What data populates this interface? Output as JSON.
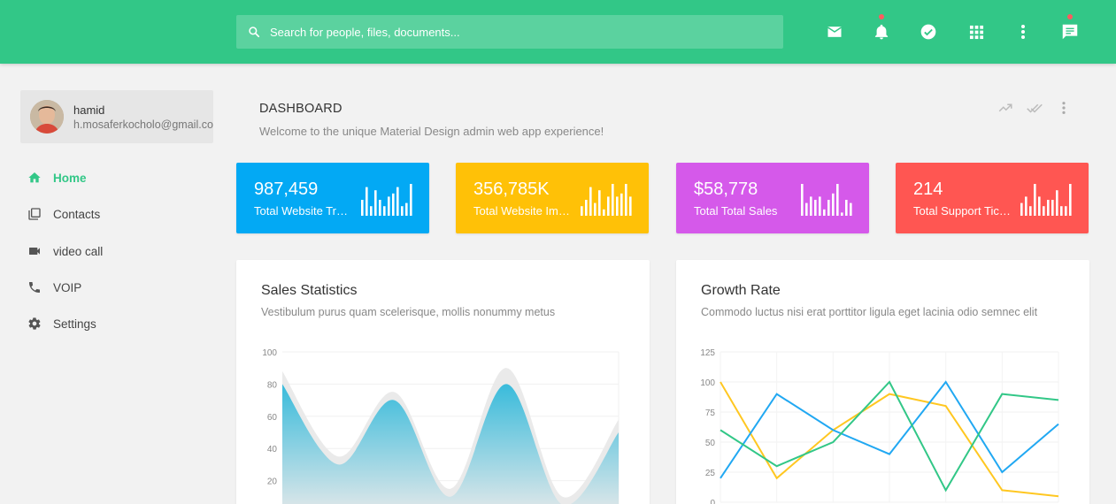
{
  "search": {
    "placeholder": "Search for people, files, documents..."
  },
  "header_icons": [
    "mail-icon",
    "notifications-icon",
    "tasks-check-icon",
    "apps-grid-icon",
    "more-vertical-icon",
    "messages-icon"
  ],
  "profile": {
    "name": "hamid",
    "email": "h.mosaferkocholo@gmail.com"
  },
  "nav": [
    {
      "label": "Home",
      "icon": "home-icon",
      "active": true
    },
    {
      "label": "Contacts",
      "icon": "contacts-icon",
      "active": false
    },
    {
      "label": "video call",
      "icon": "videocam-icon",
      "active": false
    },
    {
      "label": "VOIP",
      "icon": "phone-icon",
      "active": false
    },
    {
      "label": "Settings",
      "icon": "settings-icon",
      "active": false
    }
  ],
  "page": {
    "title": "DASHBOARD",
    "subtitle": "Welcome to the unique Material Design admin web app experience!"
  },
  "colors": {
    "brand": "#32c787",
    "blue": "#03a9f4",
    "amber": "#ffc107",
    "purple": "#d559ea",
    "red": "#ff5652",
    "area": "#39bbdb"
  },
  "stats": [
    {
      "value": "987,459",
      "label": "Total Website Traffics",
      "color": "#03a9f4",
      "bars": [
        5,
        9,
        3,
        8,
        5,
        3,
        6,
        7,
        9,
        3,
        4,
        10
      ]
    },
    {
      "value": "356,785K",
      "label": "Total Website Impressions",
      "color": "#ffc107",
      "bars": [
        3,
        5,
        9,
        4,
        8,
        2,
        6,
        10,
        6,
        7,
        10,
        6
      ]
    },
    {
      "value": "$58,778",
      "label": "Total Total Sales",
      "color": "#d559ea",
      "bars": [
        10,
        4,
        6,
        5,
        6,
        2,
        5,
        7,
        10,
        1,
        5,
        4
      ]
    },
    {
      "value": "214",
      "label": "Total Support Tickets",
      "color": "#ff5652",
      "bars": [
        4,
        6,
        3,
        10,
        6,
        3,
        5,
        5,
        8,
        3,
        3,
        10
      ]
    }
  ],
  "sales": {
    "title": "Sales Statistics",
    "subtitle": "Vestibulum purus quam scelerisque, mollis nonummy metus"
  },
  "growth": {
    "title": "Growth Rate",
    "subtitle": "Commodo luctus nisi erat porttitor ligula eget lacinia odio semnec elit"
  },
  "chart_data": [
    {
      "type": "area",
      "title": "Sales Statistics",
      "x": [
        0,
        1,
        2,
        3,
        4,
        5,
        6
      ],
      "ylim": [
        0,
        100
      ],
      "yticks": [
        20,
        40,
        60,
        80,
        100
      ],
      "series": [
        {
          "values": [
            88,
            35,
            75,
            15,
            90,
            10,
            58
          ],
          "color": "#e8e8e8"
        },
        {
          "values": [
            80,
            30,
            70,
            10,
            80,
            5,
            50
          ],
          "color": "#39bbdb"
        }
      ],
      "grid": true
    },
    {
      "type": "line",
      "title": "Growth Rate",
      "x": [
        0,
        1,
        2,
        3,
        4,
        5,
        6
      ],
      "ylim": [
        0,
        125
      ],
      "yticks": [
        0,
        25,
        50,
        75,
        100,
        125
      ],
      "series": [
        {
          "values": [
            100,
            20,
            60,
            90,
            80,
            10,
            5
          ],
          "color": "#ffc721"
        },
        {
          "values": [
            20,
            90,
            60,
            40,
            100,
            25,
            65
          ],
          "color": "#21a8f2"
        },
        {
          "values": [
            60,
            30,
            50,
            100,
            10,
            90,
            85
          ],
          "color": "#32c787"
        }
      ],
      "grid": true
    }
  ]
}
